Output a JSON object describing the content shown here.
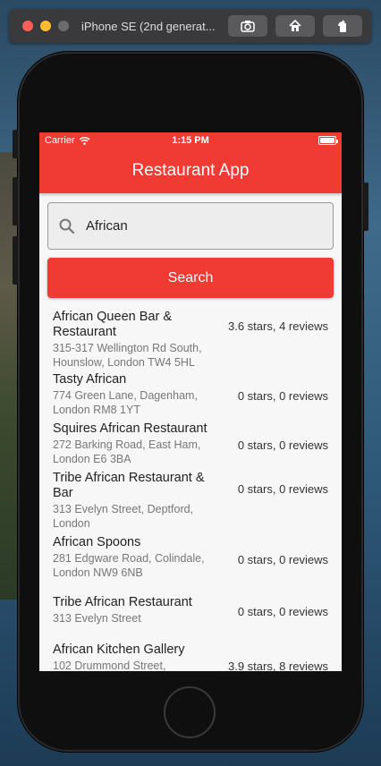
{
  "simulator": {
    "title": "iPhone SE (2nd generat...",
    "buttons": [
      "screenshot-icon",
      "home-icon",
      "rotate-icon"
    ]
  },
  "status_bar": {
    "carrier": "Carrier",
    "time": "1:15 PM"
  },
  "nav": {
    "title": "Restaurant App"
  },
  "search": {
    "value": "African",
    "button_label": "Search"
  },
  "results": [
    {
      "name": "African Queen Bar & Restaurant",
      "address": "315-317 Wellington Rd South, Hounslow, London TW4 5HL",
      "rating": "3.6 stars, 4 reviews"
    },
    {
      "name": "Tasty African",
      "address": "774 Green Lane, Dagenham, London RM8 1YT",
      "rating": "0 stars, 0 reviews"
    },
    {
      "name": "Squires African Restaurant",
      "address": "272 Barking Road, East Ham, London E6 3BA",
      "rating": "0 stars, 0 reviews"
    },
    {
      "name": "Tribe African Restaurant & Bar",
      "address": "313 Evelyn Street, Deptford, London",
      "rating": "0 stars, 0 reviews"
    },
    {
      "name": "African Spoons",
      "address": "281 Edgware Road, Colindale, London NW9 6NB",
      "rating": "0 stars, 0 reviews"
    },
    {
      "name": "Tribe African Restaurant",
      "address": "313 Evelyn Street",
      "rating": "0 stars, 0 reviews"
    },
    {
      "name": "African Kitchen Gallery",
      "address": "102 Drummond Street,",
      "rating": "3.9 stars, 8 reviews"
    }
  ],
  "colors": {
    "accent": "#f03a34"
  }
}
